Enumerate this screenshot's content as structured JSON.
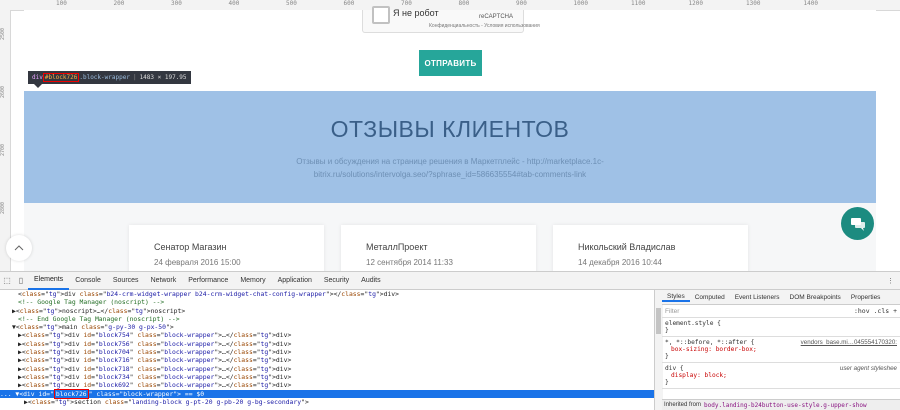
{
  "ruler": {
    "top_marks": [
      "100",
      "200",
      "300",
      "400",
      "500",
      "600",
      "700",
      "800",
      "900",
      "1000",
      "1100",
      "1200",
      "1300",
      "1400"
    ],
    "left_marks": [
      "2500",
      "2600",
      "2700",
      "2800"
    ]
  },
  "captcha": {
    "label": "Я не робот",
    "brand": "reCAPTCHA",
    "privacy": "Конфиденциальность - Условия использования"
  },
  "form": {
    "submit_label": "ОТПРАВИТЬ"
  },
  "tooltip": {
    "tag": "div",
    "id": "#block726",
    "cls": ".block-wrapper",
    "size": "1483 × 197.95"
  },
  "reviews": {
    "title": "ОТЗЫВЫ КЛИЕНТОВ",
    "description": "Отзывы и обсуждения на странице решения в Маркетплейс - http://marketplace.1c-bitrix.ru/solutions/intervolga.seo/?sphrase_id=586635554#tab-comments-link",
    "cards": [
      {
        "name": "Сенатор Магазин",
        "date": "24 февраля 2016 15:00"
      },
      {
        "name": "МеталлПроект",
        "date": "12 сентября 2014 11:33"
      },
      {
        "name": "Никольский Владислав",
        "date": "14 декабря 2016 10:44"
      }
    ]
  },
  "devtools": {
    "tabs": [
      "Elements",
      "Console",
      "Sources",
      "Network",
      "Performance",
      "Memory",
      "Application",
      "Security",
      "Audits"
    ],
    "active_tab": "Elements",
    "dom_lines": [
      {
        "indent": 2,
        "text": "<div class=\"b24-crm-widget-wrapper b24-crm-widget-chat-config-wrapper\"></div>"
      },
      {
        "indent": 2,
        "text": "<!-- Google Tag Manager (noscript) -->",
        "comment": true
      },
      {
        "indent": 1,
        "text": "▶<noscript>…</noscript>"
      },
      {
        "indent": 2,
        "text": "<!-- End Google Tag Manager (noscript) -->",
        "comment": true
      },
      {
        "indent": 1,
        "text": "▼<main class=\"g-py-30 g-px-50\">"
      },
      {
        "indent": 2,
        "text": "▶<div id=\"block754\" class=\"block-wrapper\">…</div>"
      },
      {
        "indent": 2,
        "text": "▶<div id=\"block756\" class=\"block-wrapper\">…</div>"
      },
      {
        "indent": 2,
        "text": "▶<div id=\"block704\" class=\"block-wrapper\">…</div>"
      },
      {
        "indent": 2,
        "text": "▶<div id=\"block716\" class=\"block-wrapper\">…</div>"
      },
      {
        "indent": 2,
        "text": "▶<div id=\"block718\" class=\"block-wrapper\">…</div>"
      },
      {
        "indent": 2,
        "text": "▶<div id=\"block734\" class=\"block-wrapper\">…</div>"
      },
      {
        "indent": 2,
        "text": "▶<div id=\"block692\" class=\"block-wrapper\">…</div>"
      }
    ],
    "selected_line": {
      "pre": "...  ▼<div id=\"",
      "id": "block726",
      "post": "\" class=\"block-wrapper\"> == $0"
    },
    "last_line": "▶<section class=\"landing-block g-pt-20 g-pb-20 g-bg-secondary\">",
    "styles_tabs": [
      "Styles",
      "Computed",
      "Event Listeners",
      "DOM Breakpoints",
      "Properties"
    ],
    "filter_placeholder": "Filter",
    "filter_right": ":hov  .cls  +",
    "rules": [
      {
        "selector": "element.style {",
        "source": "",
        "props": [],
        "close": "}"
      },
      {
        "selector": "*, *::before, *::after {",
        "source": "vendors_base.mi…045554170320:",
        "props": [
          "box-sizing: border-box;"
        ],
        "close": "}"
      },
      {
        "selector": "div {",
        "source": "user agent styleshee",
        "props": [
          "display: block;"
        ],
        "close": "}"
      }
    ],
    "inherited_label": "Inherited from",
    "inherited_value": "body.landing-b24button-use-style.g-upper-show"
  }
}
